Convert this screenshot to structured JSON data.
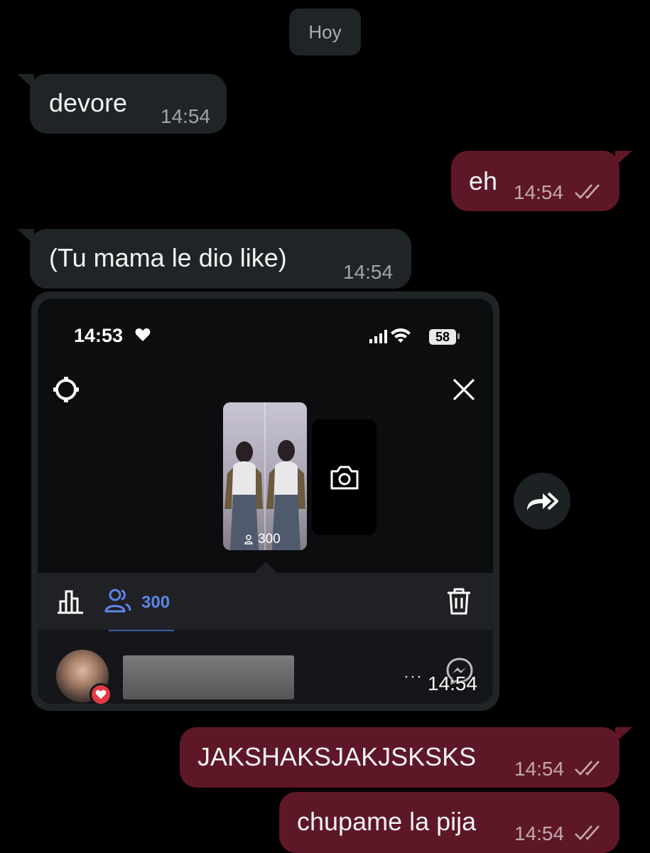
{
  "date_separator": "Hoy",
  "messages": [
    {
      "direction": "in",
      "text": "devore",
      "time": "14:54"
    },
    {
      "direction": "out",
      "text": "eh",
      "time": "14:54",
      "status": "read"
    },
    {
      "direction": "in",
      "text": "(Tu mama le dio like)",
      "time": "14:54"
    },
    {
      "direction": "out",
      "text": "JAKSHAKSJAKJSKSKS",
      "time": "14:54",
      "status": "read"
    },
    {
      "direction": "out",
      "text": "chupame la pija",
      "time": "14:54",
      "status": "read"
    }
  ],
  "media": {
    "time": "14:54",
    "screenshot": {
      "status_time": "14:53",
      "battery": "58",
      "story_viewers": "300",
      "viewers_count": "300"
    }
  },
  "colors": {
    "background": "#000000",
    "incoming_bubble": "#1f2426",
    "outgoing_bubble": "#5e1726",
    "viewers_accent": "#5d86e8",
    "like_badge": "#e53945"
  }
}
